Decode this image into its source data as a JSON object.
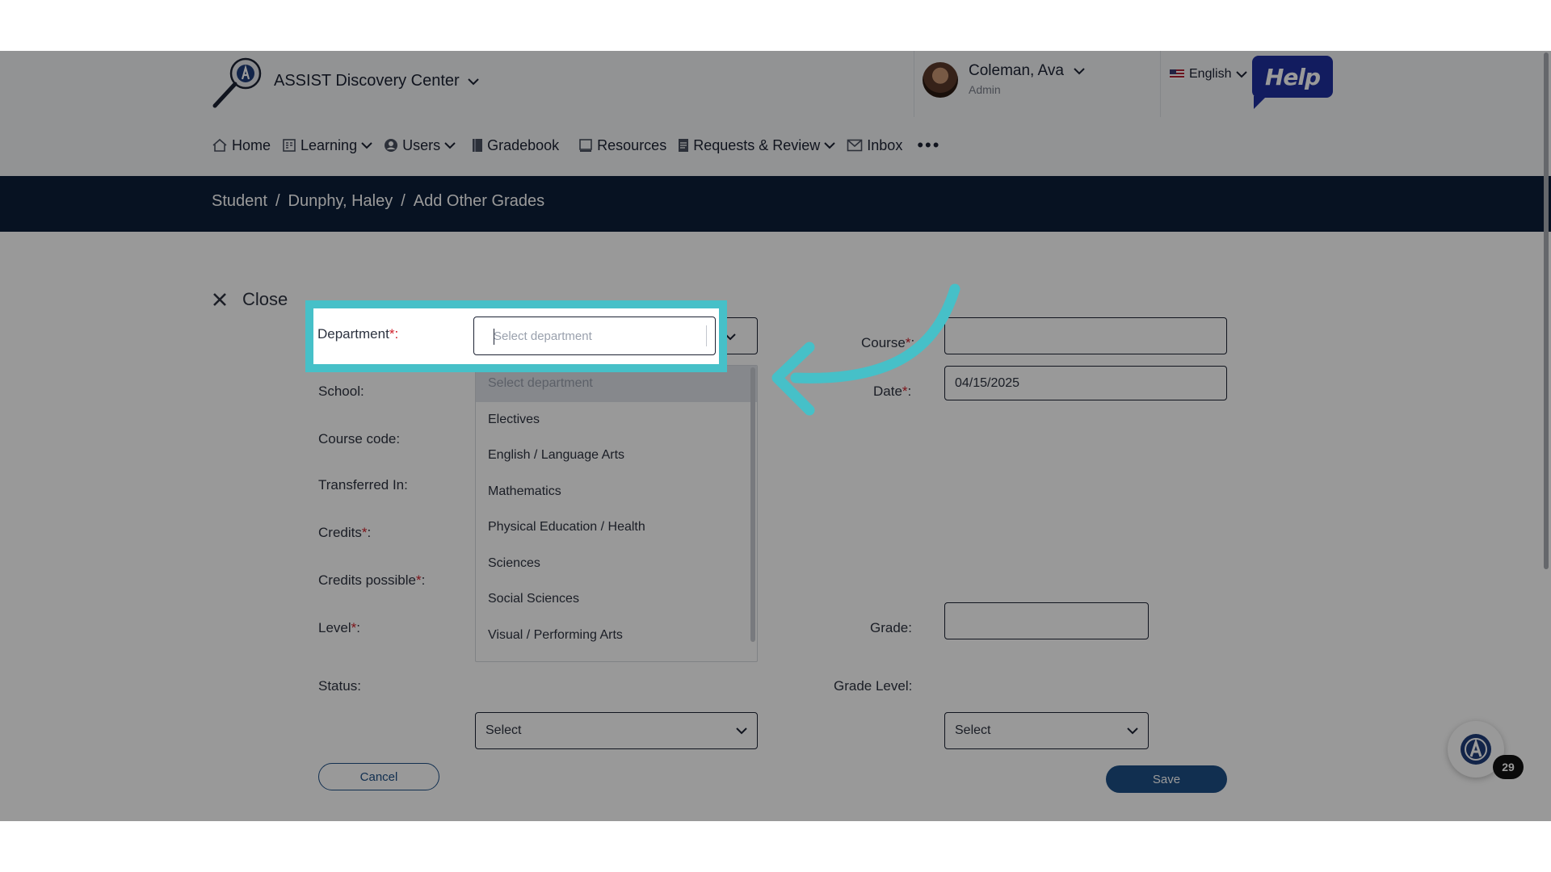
{
  "header": {
    "app_title": "ASSIST Discovery Center",
    "user_name": "Coleman, Ava",
    "user_role": "Admin",
    "language": "English",
    "help_label": "Help"
  },
  "nav": {
    "items": [
      {
        "label": "Home",
        "icon": "home-icon"
      },
      {
        "label": "Learning",
        "icon": "learning-icon",
        "dropdown": true
      },
      {
        "label": "Users",
        "icon": "user-icon",
        "dropdown": true
      },
      {
        "label": "Gradebook",
        "icon": "gradebook-icon"
      },
      {
        "label": "Resources",
        "icon": "resources-icon"
      },
      {
        "label": "Requests & Review",
        "icon": "requests-icon",
        "dropdown": true
      },
      {
        "label": "Inbox",
        "icon": "inbox-icon"
      }
    ],
    "more_label": "•••"
  },
  "breadcrumb": [
    "Student",
    "/",
    "Dunphy, Haley",
    "/",
    "Add Other Grades"
  ],
  "close_label": "Close",
  "form": {
    "department_label": "Department",
    "department_placeholder": "Select department",
    "school_label": "School",
    "course_code_label": "Course code",
    "transferred_in_label": "Transferred In",
    "credits_label": "Credits",
    "credits_possible_label": "Credits possible",
    "level_label": "Level",
    "status_label": "Status",
    "status_value": "Select",
    "course_label": "Course",
    "date_label": "Date",
    "date_value": "04/15/2025",
    "grade_label": "Grade",
    "grade_level_label": "Grade Level",
    "grade_level_value": "Select",
    "required_mark": "*",
    "label_suffix": ":"
  },
  "department_options": [
    "Select department",
    "Electives",
    "English / Language Arts",
    "Mathematics",
    "Physical Education / Health",
    "Sciences",
    "Social Sciences",
    "Visual / Performing Arts"
  ],
  "buttons": {
    "cancel": "Cancel",
    "save": "Save"
  },
  "notifications": {
    "count": "29"
  },
  "colors": {
    "accent": "#46c0c8",
    "primary": "#1d4f86",
    "crumb_bar": "#0c1e3a",
    "help": "#1f2f9e",
    "required": "#d0202b"
  }
}
